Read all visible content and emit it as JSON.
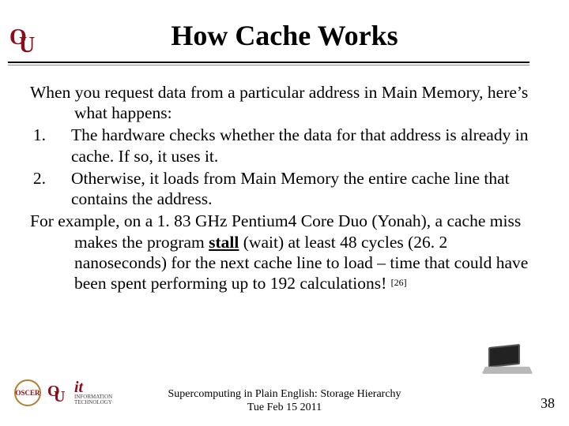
{
  "title": "How Cache Works",
  "intro": "When you request data from a particular address in Main Memory, here’s what happens:",
  "items": [
    {
      "n": "1.",
      "text": "The hardware checks whether the data for that address is already in cache. If so, it uses it."
    },
    {
      "n": "2.",
      "text": "Otherwise, it loads from Main Memory the entire cache line that contains the address."
    }
  ],
  "example_lead": "For example, on a 1. 83 GHz Pentium4 Core Duo (Yonah), a cache miss makes the program ",
  "example_stall": "stall",
  "example_tail_before_ref": " (wait) at least 48 cycles (26. 2 nanoseconds) for the next cache line to load – time that could have been spent performing up to 192 calculations! ",
  "example_ref": "[26]",
  "footer": {
    "line1": "Supercomputing in Plain English: Storage Hierarchy",
    "line2": "Tue Feb 15 2011",
    "pagenum": "38",
    "badge_text": "OSCER",
    "it_label1": "INFORMATION",
    "it_label2": "TECHNOLOGY"
  },
  "icons": {
    "ou_O": "O",
    "ou_U": "U",
    "it": "it"
  }
}
